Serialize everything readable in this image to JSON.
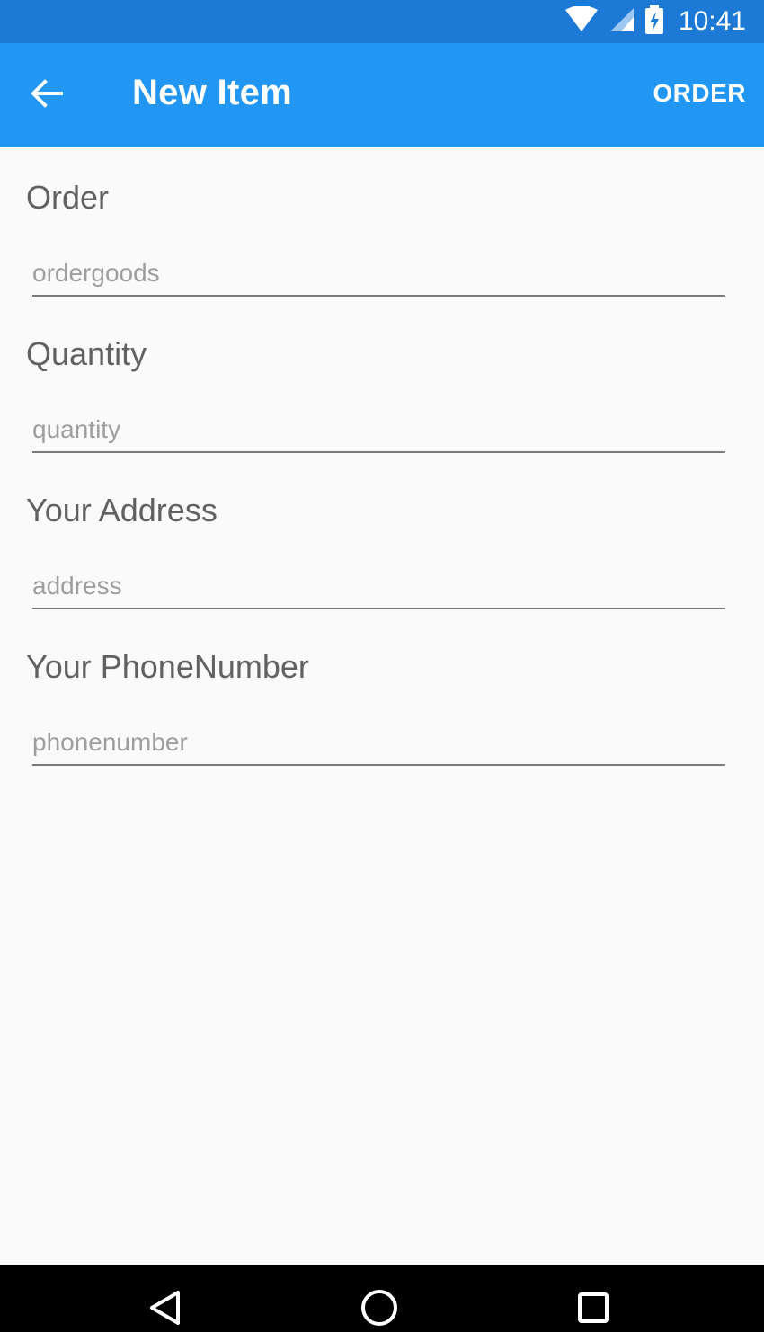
{
  "status_bar": {
    "time": "10:41",
    "icons": [
      "wifi-icon",
      "cellular-signal-icon",
      "battery-charging-icon"
    ]
  },
  "app_bar": {
    "back_icon": "arrow-left-icon",
    "title": "New Item",
    "action_label": "ORDER",
    "background_color": "#2196f3"
  },
  "form": {
    "fields": [
      {
        "label": "Order",
        "placeholder": "ordergoods",
        "value": ""
      },
      {
        "label": "Quantity",
        "placeholder": "quantity",
        "value": ""
      },
      {
        "label": "Your Address",
        "placeholder": "address",
        "value": ""
      },
      {
        "label": "Your PhoneNumber",
        "placeholder": "phonenumber",
        "value": ""
      }
    ]
  },
  "nav_bar": {
    "buttons": [
      "back-triangle-icon",
      "home-circle-icon",
      "recents-square-icon"
    ]
  }
}
